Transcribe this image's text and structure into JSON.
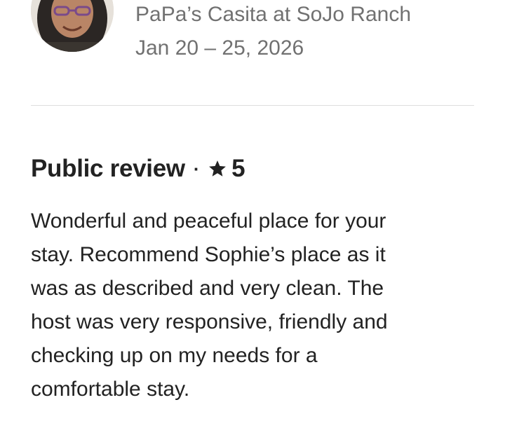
{
  "host": {
    "avatar_icon": "host-avatar-photo",
    "listing_name": "PaPa’s Casita at SoJo Ranch",
    "trip_dates": "Jan 20 – 25, 2026"
  },
  "review": {
    "heading": "Public review",
    "separator": "·",
    "star_icon": "star-icon",
    "rating": "5",
    "body_lines": [
      "Wonderful and peaceful place for your",
      "stay. Recommend Sophie’s place as it",
      "was as described and very clean. The",
      "host was very responsive, friendly and",
      "checking up on my needs for a",
      "comfortable stay."
    ]
  },
  "colors": {
    "primary_text": "#222222",
    "secondary_text": "#717171",
    "divider": "#dddddd"
  }
}
